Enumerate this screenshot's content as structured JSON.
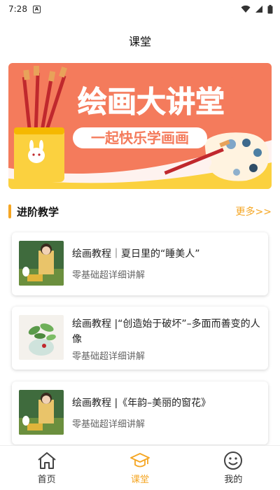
{
  "status": {
    "time": "7:28",
    "notif_icon": "a-icon"
  },
  "header": {
    "title": "课堂"
  },
  "banner": {
    "headline": "绘画大讲堂",
    "subline": "一起快乐学画画"
  },
  "section": {
    "title": "进阶教学",
    "more": "更多>>"
  },
  "cards": [
    {
      "title": "绘画教程｜夏日里的“睡美人”",
      "subtitle": "零基础超详细讲解"
    },
    {
      "title": "绘画教程 |“创造始于破坏”–多面而善变的人像",
      "subtitle": "零基础超详细讲解"
    },
    {
      "title": "绘画教程 |《年韵–美丽的窗花》",
      "subtitle": "零基础超详细讲解"
    }
  ],
  "tabs": [
    {
      "label": "首页",
      "icon": "home-icon",
      "active": false
    },
    {
      "label": "课堂",
      "icon": "graduation-cap-icon",
      "active": true
    },
    {
      "label": "我的",
      "icon": "smiley-icon",
      "active": false
    }
  ],
  "colors": {
    "accent": "#f5a623",
    "banner_bg": "#f47b5c",
    "banner_yellow": "#fbd13f"
  }
}
